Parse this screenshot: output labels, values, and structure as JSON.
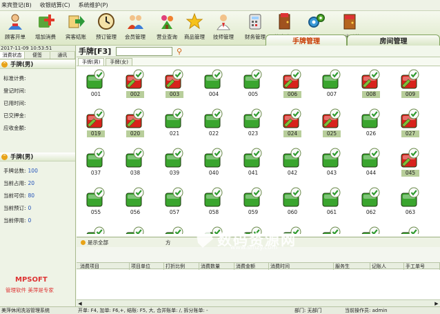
{
  "menu": [
    "来宾登记(B)",
    "收银结算(C)",
    "系统维护(P)"
  ],
  "toolbar": {
    "items": [
      {
        "label": "顾客开单",
        "icon": "person-icon"
      },
      {
        "label": "增加消费",
        "icon": "add-icon"
      },
      {
        "label": "宾客结账",
        "icon": "arrow-icon"
      },
      {
        "label": "预订管理",
        "icon": "clock-icon"
      },
      {
        "label": "会员管理",
        "icon": "people-icon"
      },
      {
        "label": "营业查询",
        "icon": "flowers-icon"
      },
      {
        "label": "商品管理",
        "icon": "star-icon"
      },
      {
        "label": "技师管理",
        "icon": "staff-icon"
      },
      {
        "label": "财务管理",
        "icon": "calculator-icon"
      },
      {
        "label": "换班登录",
        "icon": "door-icon"
      },
      {
        "label": "系统设置",
        "icon": "gears-icon"
      },
      {
        "label": "退出系统",
        "icon": "exit-icon"
      }
    ]
  },
  "app_tabs": {
    "card_mgmt": "手牌管理",
    "room_mgmt": "房间管理"
  },
  "left": {
    "datetime": "2017-11-09  10:53:51",
    "tabs": [
      "消费状态",
      "便签",
      "通讯"
    ],
    "section1": {
      "title": "手牌(男)",
      "fields": [
        "标准计费:",
        "登记时间:",
        "已用时间:",
        "已交押金:",
        "应收金额:"
      ]
    },
    "section2": {
      "title": "手牌(男)",
      "stats": [
        {
          "label": "手牌总数:",
          "value": "100"
        },
        {
          "label": "当前占用:",
          "value": "20"
        },
        {
          "label": "当前可供:",
          "value": "80"
        },
        {
          "label": "当前预订:",
          "value": "0"
        },
        {
          "label": "当前停用:",
          "value": "0"
        }
      ]
    },
    "logo": "MPSOFT",
    "slogan": "管理软件  美萍是专家"
  },
  "content": {
    "title": "手牌[F3]",
    "search_value": "",
    "search_icon": "search-icon",
    "subtabs": [
      "手牌(男)",
      "手牌(女)"
    ],
    "tiles": [
      {
        "label": "001",
        "status": "free"
      },
      {
        "label": "002",
        "status": "occupied"
      },
      {
        "label": "003",
        "status": "occupied"
      },
      {
        "label": "004",
        "status": "free"
      },
      {
        "label": "005",
        "status": "free"
      },
      {
        "label": "006",
        "status": "occupied"
      },
      {
        "label": "007",
        "status": "free"
      },
      {
        "label": "008",
        "status": "occupied"
      },
      {
        "label": "009",
        "status": "occupied"
      },
      {
        "label": "019",
        "status": "occupied"
      },
      {
        "label": "020",
        "status": "occupied"
      },
      {
        "label": "021",
        "status": "free"
      },
      {
        "label": "022",
        "status": "free"
      },
      {
        "label": "023",
        "status": "free"
      },
      {
        "label": "024",
        "status": "occupied"
      },
      {
        "label": "025",
        "status": "occupied"
      },
      {
        "label": "026",
        "status": "free"
      },
      {
        "label": "027",
        "status": "occupied"
      },
      {
        "label": "037",
        "status": "free"
      },
      {
        "label": "038",
        "status": "free"
      },
      {
        "label": "039",
        "status": "free"
      },
      {
        "label": "040",
        "status": "free"
      },
      {
        "label": "041",
        "status": "free"
      },
      {
        "label": "042",
        "status": "free"
      },
      {
        "label": "043",
        "status": "free"
      },
      {
        "label": "044",
        "status": "free"
      },
      {
        "label": "045",
        "status": "occupied"
      },
      {
        "label": "055",
        "status": "free"
      },
      {
        "label": "056",
        "status": "free"
      },
      {
        "label": "057",
        "status": "free"
      },
      {
        "label": "058",
        "status": "free"
      },
      {
        "label": "059",
        "status": "free"
      },
      {
        "label": "060",
        "status": "free"
      },
      {
        "label": "061",
        "status": "free"
      },
      {
        "label": "062",
        "status": "free"
      },
      {
        "label": "063",
        "status": "free"
      },
      {
        "label": "",
        "status": "free"
      },
      {
        "label": "",
        "status": "free"
      },
      {
        "label": "",
        "status": "free"
      },
      {
        "label": "",
        "status": "free"
      },
      {
        "label": "",
        "status": "free"
      },
      {
        "label": "",
        "status": "free"
      },
      {
        "label": "",
        "status": "free"
      },
      {
        "label": "",
        "status": "free"
      },
      {
        "label": "",
        "status": "free"
      }
    ]
  },
  "consumption": {
    "show_all": "是示全部",
    "mid_label": "方",
    "columns": [
      "消费项目",
      "项目单位",
      "打折比例",
      "消费数量",
      "消费金额",
      "消费时间",
      "服务生",
      "记账人",
      "手工单号"
    ]
  },
  "status_bar": {
    "app_name": "美萍休闲洗浴管理系统",
    "shortcuts": "开单: F4, 加单: F6,+, 结账: F5, 大, 合并账单: /, 拆分账单: -",
    "dept": "部门: 无部门",
    "operator": "当前操作员: admin"
  },
  "colors": {
    "free_tile": "#3aa52e",
    "occupied_tile": "#d8221c",
    "accent": "#e8a318",
    "active_tab_text": "#c83a00"
  },
  "watermark": {
    "text": "数码资源网",
    "url": "www.smzy.com"
  }
}
